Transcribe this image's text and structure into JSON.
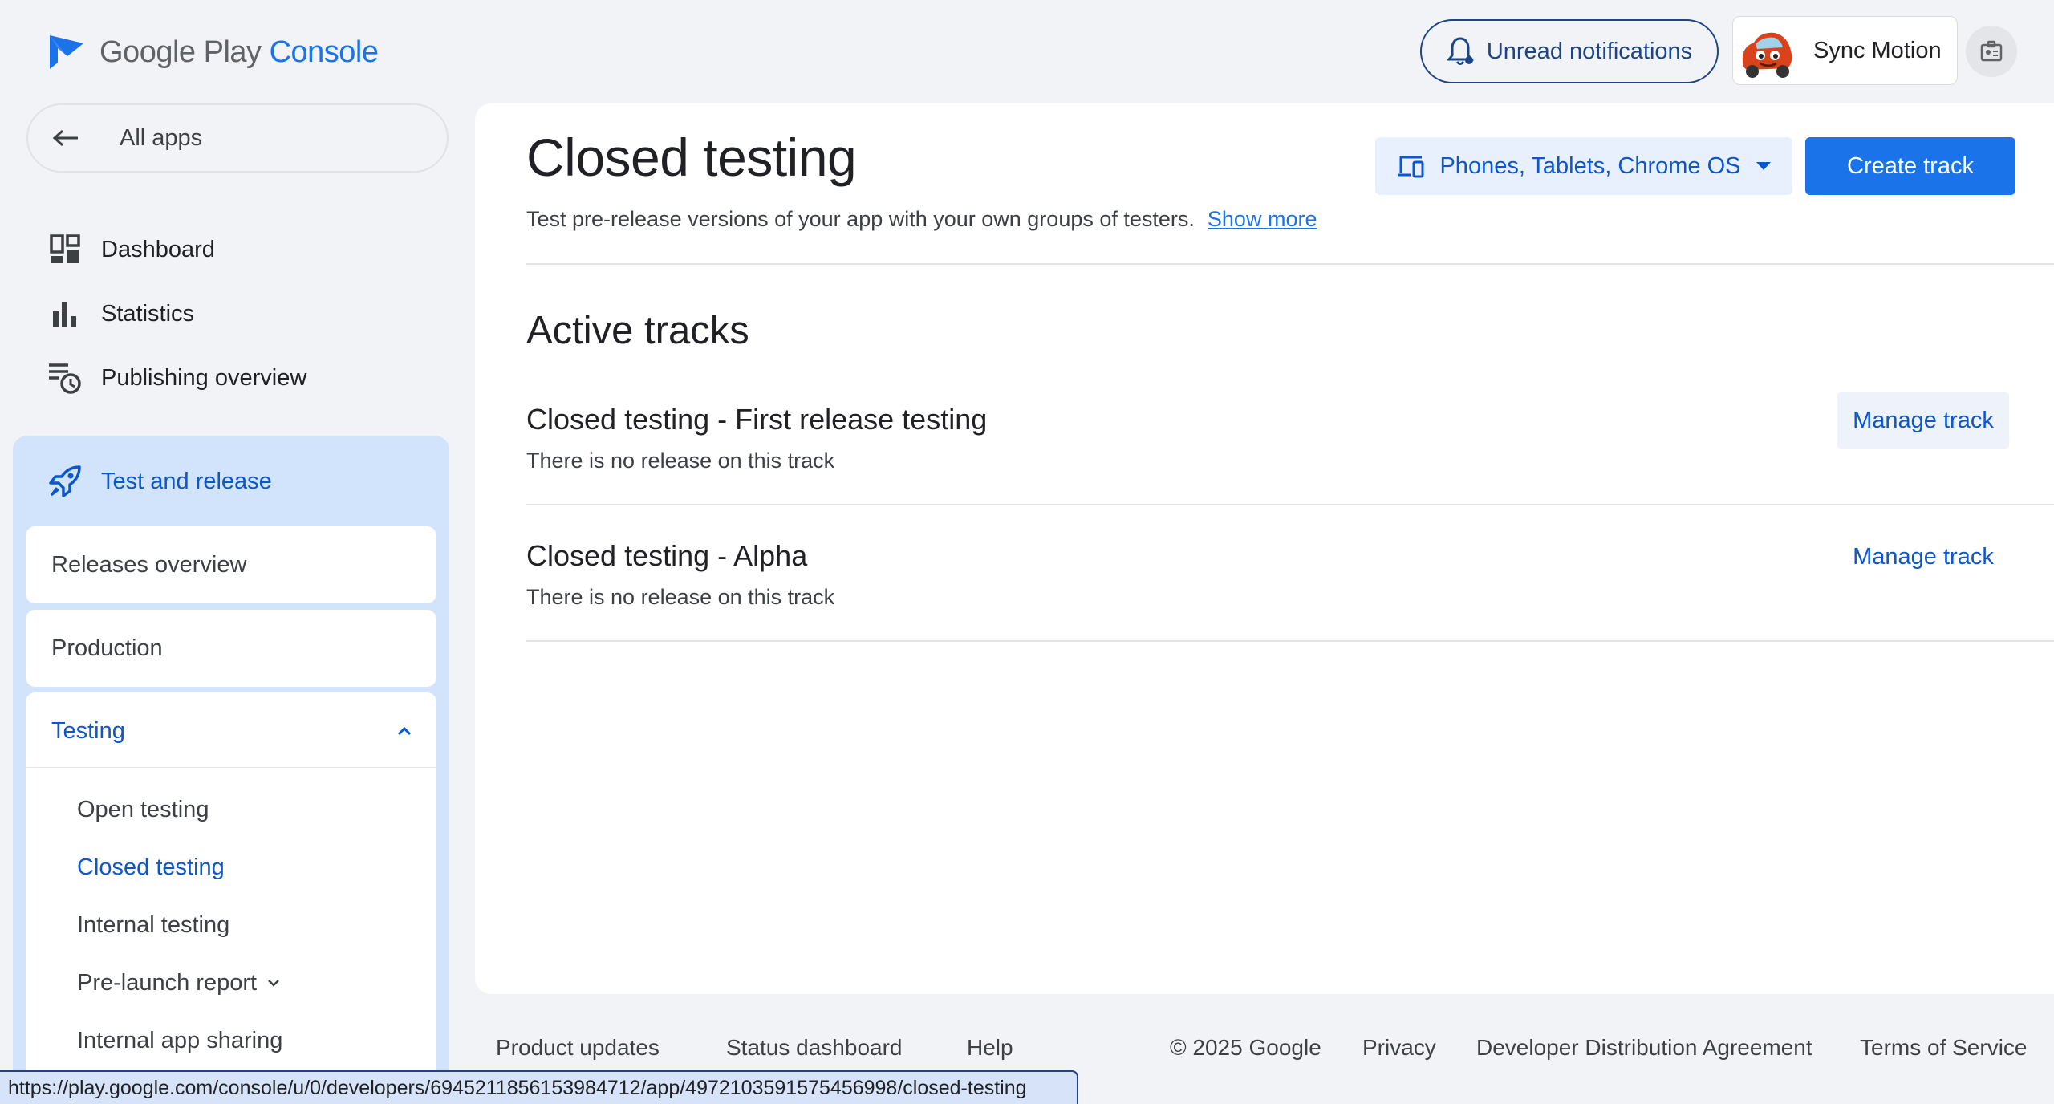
{
  "header": {
    "logo_google": "Google Play",
    "logo_console": "Console",
    "notifications_label": "Unread notifications",
    "account_name": "Sync Motion"
  },
  "sidebar": {
    "all_apps": "All apps",
    "items": [
      {
        "label": "Dashboard",
        "icon": "dashboard-icon"
      },
      {
        "label": "Statistics",
        "icon": "bar-chart-icon"
      },
      {
        "label": "Publishing overview",
        "icon": "publishing-history-icon"
      }
    ],
    "test_and_release": {
      "label": "Test and release",
      "icon": "rocket-icon",
      "releases_overview": "Releases overview",
      "production": "Production",
      "testing": {
        "label": "Testing",
        "expanded": true,
        "items": [
          {
            "label": "Open testing",
            "active": false
          },
          {
            "label": "Closed testing",
            "active": true
          },
          {
            "label": "Internal testing",
            "active": false
          },
          {
            "label": "Pre-launch report",
            "active": false,
            "has_chevron": true
          },
          {
            "label": "Internal app sharing",
            "active": false
          }
        ]
      }
    }
  },
  "main": {
    "title": "Closed testing",
    "device_selector": "Phones, Tablets, Chrome OS",
    "create_button": "Create track",
    "description": "Test pre-release versions of your app with your own groups of testers.",
    "show_more": "Show more",
    "section_title": "Active tracks",
    "tracks": [
      {
        "name": "Closed testing - First release testing",
        "status": "There is no release on this track",
        "action": "Manage track"
      },
      {
        "name": "Closed testing - Alpha",
        "status": "There is no release on this track",
        "action": "Manage track"
      }
    ]
  },
  "footer": {
    "product_updates": "Product updates",
    "status_dashboard": "Status dashboard",
    "help": "Help",
    "copyright": "© 2025 Google",
    "privacy": "Privacy",
    "dda": "Developer Distribution Agreement",
    "terms": "Terms of Service"
  },
  "status_url": "https://play.google.com/console/u/0/developers/6945211856153984712/app/4972103591575456998/closed-testing",
  "colors": {
    "accent": "#1a73e8",
    "active_text": "#0b57d0",
    "nav_panel": "#d2e3fc",
    "background": "#f1f3f7"
  }
}
